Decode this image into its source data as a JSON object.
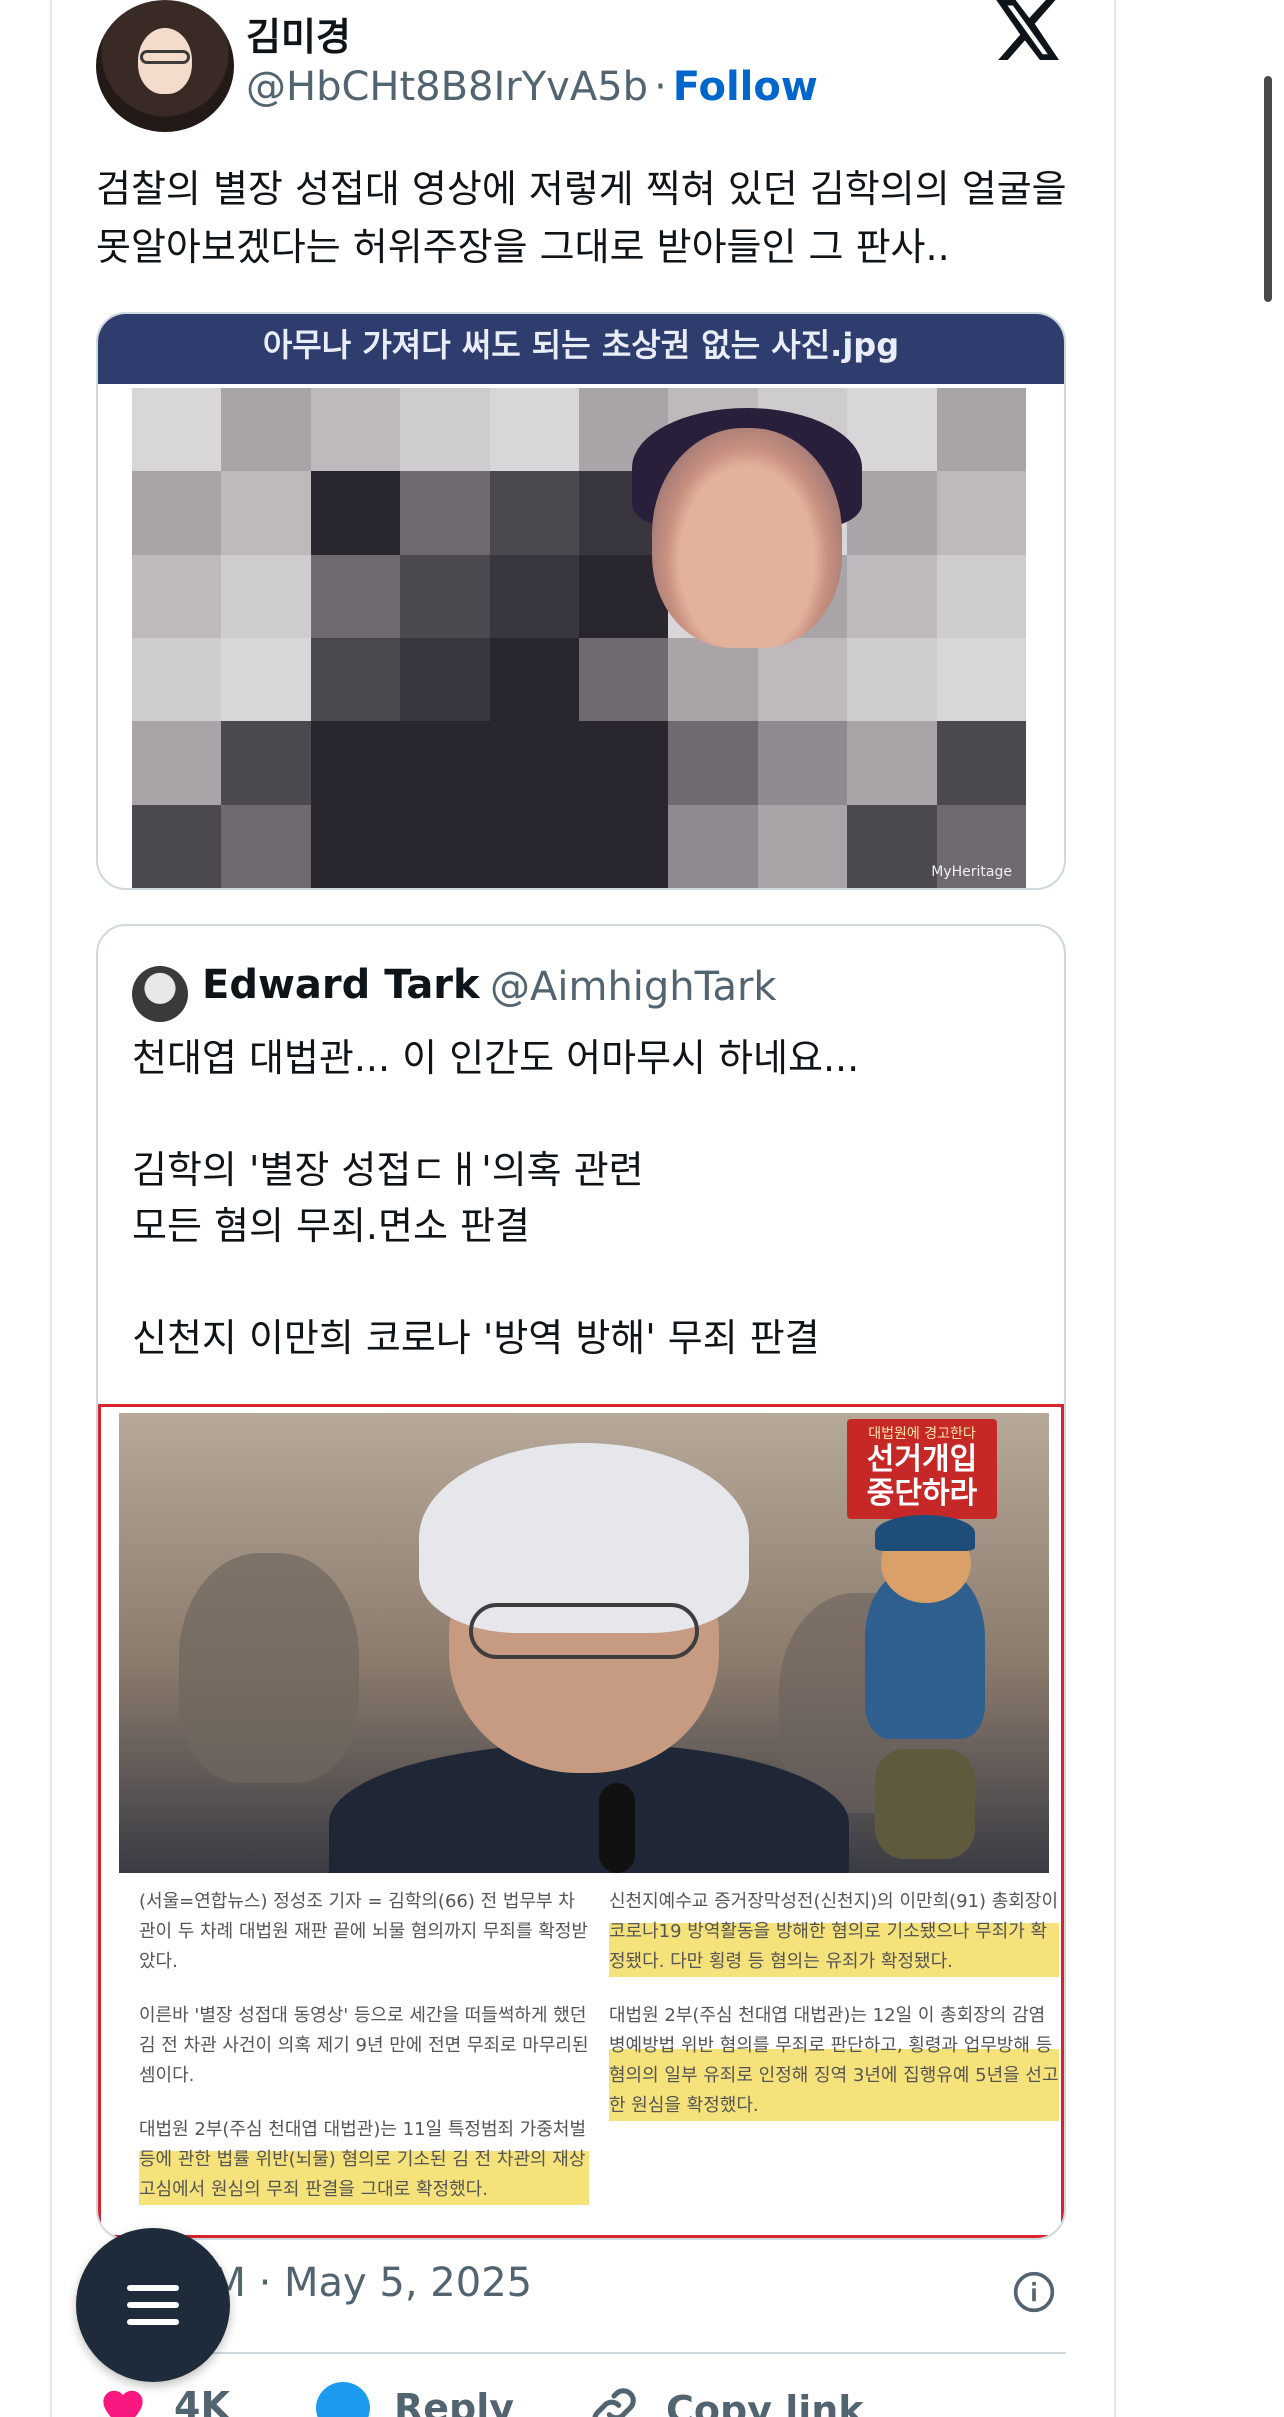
{
  "tweet": {
    "author_name": "김미경",
    "author_handle": "@HbCHt8B8IrYvA5b",
    "separator": "·",
    "follow_label": "Follow",
    "text": "검찰의 별장 성접대 영상에 저렇게 찍혀 있던 김학의의 얼굴을 못알아보겠다는 허위주장을 그대로 받아들인 그 판사..",
    "image_banner": "아무나 가져다 써도 되는 초상권 없는 사진.jpg",
    "image_watermark": "MyHeritage",
    "timestamp": "AM · May 5, 2025"
  },
  "quote": {
    "author_name": "Edward Tark",
    "author_handle": "@AimhighTark",
    "text": "천대엽 대법관... 이 인간도 어마무시 하네요...\n\n김학의 '별장 성접ㄷㅐ'의혹 관련\n모든 혐의 무죄.면소 판결\n\n신천지 이만희 코로나 '방역 방해' 무죄 판결",
    "sign_small": "대법원에 경고한다",
    "sign_line1": "선거개입",
    "sign_line2": "중단하라",
    "article_left": [
      "(서울=연합뉴스) 정성조 기자 = 김학의(66) 전 법무부 차관이 두 차례 대법원 재판 끝에 뇌물 혐의까지 무죄를 확정받았다.",
      "이른바 '별장 성접대 동영상' 등으로 세간을 떠들썩하게 했던 김 전 차관 사건이 의혹 제기 9년 만에 전면 무죄로 마무리된 셈이다.",
      "대법원 2부(주심 천대엽 대법관)는 11일 특정범죄 가중처벌 등에 관한 법률 위반(뇌물) 혐의로 기소된 김 전 차관의 재상고심에서 원심의 무죄 판결을 그대로 확정했다."
    ],
    "article_right": [
      "신천지예수교 증거장막성전(신천지)의 이만희(91) 총회장이 코로나19 방역활동을 방해한 혐의로 기소됐으나 무죄가 확정됐다. 다만 횡령 등 혐의는 유죄가 확정됐다.",
      "대법원 2부(주심 천대엽 대법관)는 12일 이 총회장의 감염병예방법 위반 혐의를 무죄로 판단하고, 횡령과 업무방해 등 혐의의 일부 유죄로 인정해 징역 3년에 집행유예 5년을 선고한 원심을 확정했다."
    ]
  },
  "actions": {
    "likes": "4K",
    "reply_label": "Reply",
    "copy_link_label": "Copy link"
  },
  "colors": {
    "follow": "#0066cc",
    "muted": "#536471",
    "border": "#cfd9de",
    "quote_media_border": "#d9232d",
    "banner": "#2f3d6e",
    "fab": "#1e2b3a",
    "like": "#f91880",
    "reply": "#1d9bf0"
  },
  "icons": [
    "x-logo-icon",
    "info-icon",
    "heart-icon",
    "reply-icon",
    "link-icon",
    "menu-icon"
  ]
}
